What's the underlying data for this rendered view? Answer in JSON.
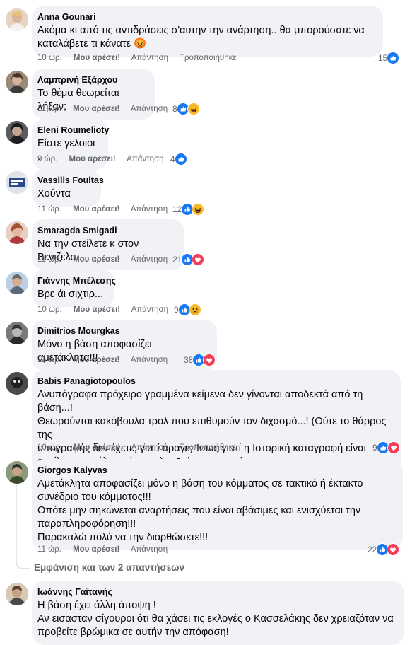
{
  "labels": {
    "like": "Μου αρέσει!",
    "reply": "Απάντηση",
    "edited": "Τροποποιήθηκε"
  },
  "comments": [
    {
      "author": "Anna Gounari",
      "lines": [
        "Ακόμα κι από τις αντιδράσεις σ'αυτην την ανάρτηση.. θα μπορούσατε να",
        "καταλάβετε τι κάνατε 😡"
      ],
      "time": "10 ώρ.",
      "edited": true,
      "count": "15",
      "reactions": [
        "like"
      ],
      "avatar": "#d8b79a"
    },
    {
      "author": "Λαμπρινή Εξάρχου",
      "lines": [
        "Το θέμα θεωρείται λήξαν;"
      ],
      "time": "11 ώρ.",
      "edited": false,
      "count": "8",
      "reactions": [
        "like",
        "haha"
      ],
      "avatar": "#7d6b5a"
    },
    {
      "author": "Eleni Roumelioty",
      "lines": [
        "Είστε γελοιοι ."
      ],
      "time": "9 ώρ.",
      "edited": false,
      "count": "4",
      "reactions": [
        "like"
      ],
      "avatar": "#3c3c40"
    },
    {
      "author": "Vassilis Foultas",
      "lines": [
        "Χούντα"
      ],
      "time": "11 ώρ.",
      "edited": false,
      "count": "12",
      "reactions": [
        "like",
        "haha"
      ],
      "avatar": "#2e4a8a"
    },
    {
      "author": "Smaragda Smigadi",
      "lines": [
        "Να την στείλετε κ στον Βενιζελο."
      ],
      "time": "11 ώρ.",
      "edited": false,
      "count": "21",
      "reactions": [
        "like",
        "love"
      ],
      "avatar": "#c88a7a"
    },
    {
      "author": "Γιάννης Μπέλεσης",
      "lines": [
        "Βρε άι σιχτιρ..."
      ],
      "time": "10 ώρ.",
      "edited": false,
      "count": "9",
      "reactions": [
        "like",
        "sad"
      ],
      "avatar": "#8aa4c0"
    },
    {
      "author": "Dimitrios Mourgkas",
      "lines": [
        "Μόνο η βάση αποφασίζει αμετάκλητα!!!"
      ],
      "time": "11 ώρ.",
      "edited": false,
      "count": "38",
      "reactions": [
        "like",
        "love"
      ],
      "avatar": "#2b2b2b"
    },
    {
      "author": "Babis Panagiotopoulos",
      "lines": [
        "Ανυπόγραφα πρόχειρο γραμμένα κείμενα δεν γίνονται αποδεκτά από τη βάση...!",
        "Θεωρούνται κακόβουλα τρολ που επιθυμούν τον διχασμό...! (Ούτε το θάρρος της",
        "υπογραφής δεν έχετε, γιατί άραγε; Ίσως γιατί η Ιστορική καταγραφή είναι",
        "αμείλικτη και όλοι κρίνονται)..."
      ],
      "see_more": "Δείτε περισσότερα",
      "time": "10 ώρ.",
      "edited": true,
      "count": "9",
      "reactions": [
        "like",
        "love"
      ],
      "avatar": "#3a3a3a"
    },
    {
      "author": "Giorgos Kalyvas",
      "lines": [
        "Αμετάκλητα αποφασίζει μόνο η βάση του κόμματος σε τακτικό ή έκτακτο",
        "συνέδριο του κόμματος!!!",
        "Οπότε μην σηκώνεται αναρτήσεις που είναι αβάσιμες και ενισχύεται την",
        "παραπληροφόρηση!!!",
        "Παρακαλώ πολύ να την διορθώσετε!!!"
      ],
      "time": "11 ώρ.",
      "edited": false,
      "count": "22",
      "reactions": [
        "like",
        "love"
      ],
      "avatar": "#5a6b4a"
    },
    {
      "author": "Ιωάννης Γαϊτανής",
      "lines": [
        "Η βάση έχει άλλη άποψη !",
        "Αν εισασταν σίγουροι ότι θα χάσει τις εκλογές ο Κασσελάκης δεν χρειαζόταν να",
        "προβείτε βρώμικα σε αυτήν την απόφαση!"
      ],
      "avatar": "#b59a7a"
    }
  ],
  "replies_link": "Εμφάνιση και των 2 απαντήσεων"
}
